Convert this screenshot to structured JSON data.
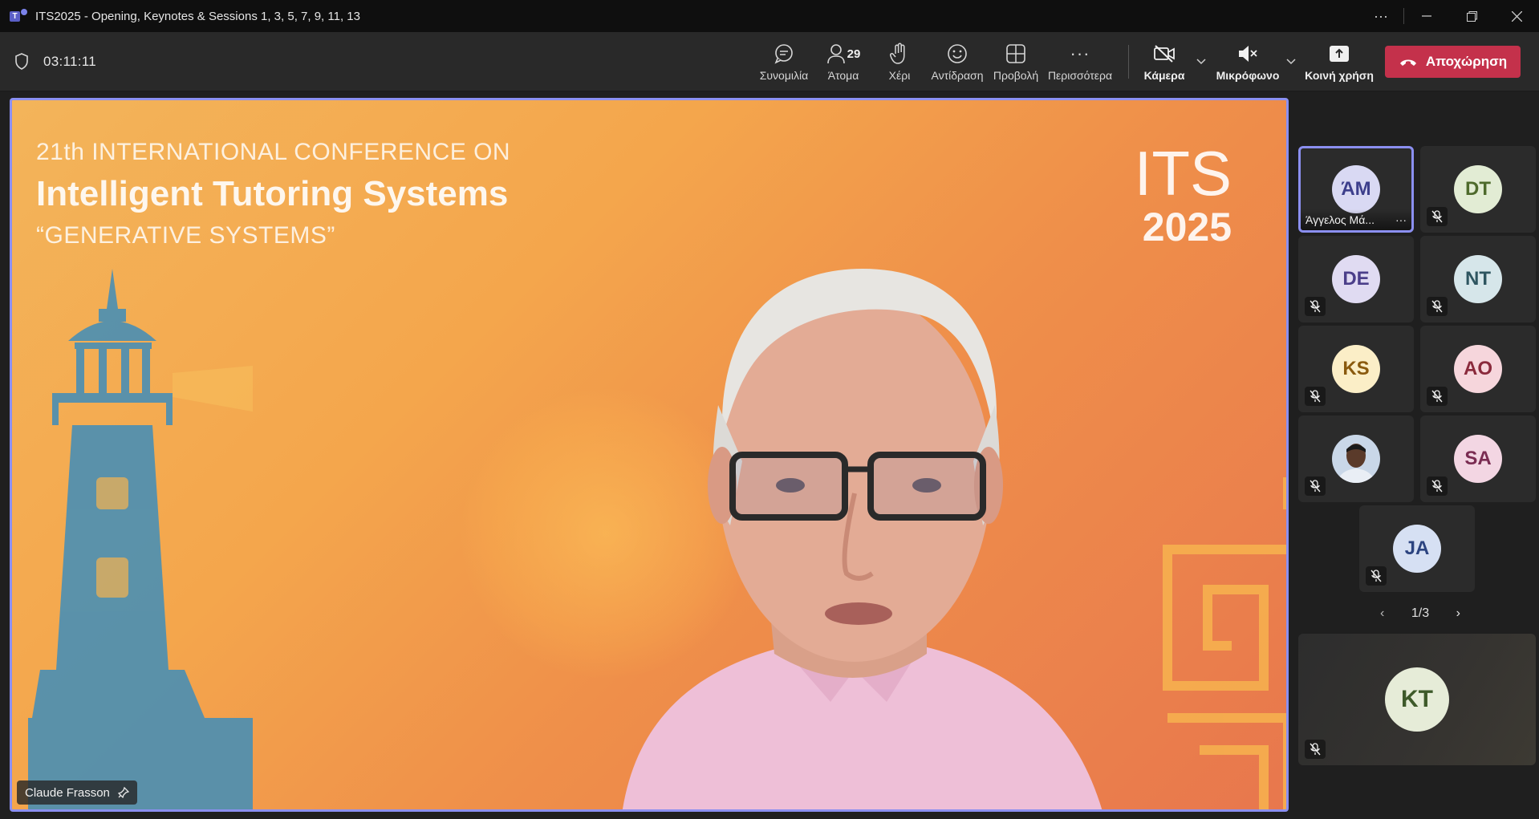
{
  "window": {
    "title": "ITS2025 - Opening, Keynotes & Sessions 1, 3, 5, 7, 9, 11, 13",
    "app_icon": "teams-icon",
    "controls": [
      "more-icon",
      "minimize-icon",
      "maximize-icon",
      "close-icon"
    ]
  },
  "toolbar": {
    "timer": "03:11:11",
    "chat_label": "Συνομιλία",
    "people_label": "Άτομα",
    "people_count": "29",
    "raise_label": "Χέρι",
    "react_label": "Αντίδραση",
    "view_label": "Προβολή",
    "more_label": "Περισσότερα",
    "camera_label": "Κάμερα",
    "mic_label": "Μικρόφωνο",
    "share_label": "Κοινή χρήση",
    "leave_label": "Αποχώρηση",
    "leave_color": "#c4314b"
  },
  "stage": {
    "slide_line1": "21th INTERNATIONAL CONFERENCE ON",
    "slide_line2": "Intelligent Tutoring Systems",
    "slide_line3": "“GENERATIVE SYSTEMS”",
    "logo_top": "ITS",
    "logo_year": "2025",
    "speaker_name": "Claude Frasson",
    "active_border": "#8b8ff0"
  },
  "participants": [
    {
      "initials": "ΆΜ",
      "name": "Άγγελος Μά...",
      "bg": "#d9d9f3",
      "fg": "#3d3f8c",
      "active": true,
      "muted": false
    },
    {
      "initials": "DT",
      "bg": "#e2ecd4",
      "fg": "#4e6a2c",
      "muted": true
    },
    {
      "initials": "DE",
      "bg": "#e0dbf2",
      "fg": "#4b3f8a",
      "muted": true
    },
    {
      "initials": "NT",
      "bg": "#d6e6ea",
      "fg": "#2e5560",
      "muted": true
    },
    {
      "initials": "KS",
      "bg": "#fbeec7",
      "fg": "#8a5a0e",
      "muted": true
    },
    {
      "initials": "AO",
      "bg": "#f6d6dc",
      "fg": "#8a2a3c",
      "muted": true
    },
    {
      "initials": "",
      "photo": true,
      "muted": true
    },
    {
      "initials": "SA",
      "bg": "#f3d6e3",
      "fg": "#7a2c52",
      "muted": true
    },
    {
      "initials": "JA",
      "bg": "#d6e0f3",
      "fg": "#2c4480",
      "muted": true
    }
  ],
  "pager": {
    "text": "1/3"
  },
  "self_tile": {
    "initials": "KT",
    "bg": "#e6ecd8",
    "fg": "#3e5a2a"
  }
}
